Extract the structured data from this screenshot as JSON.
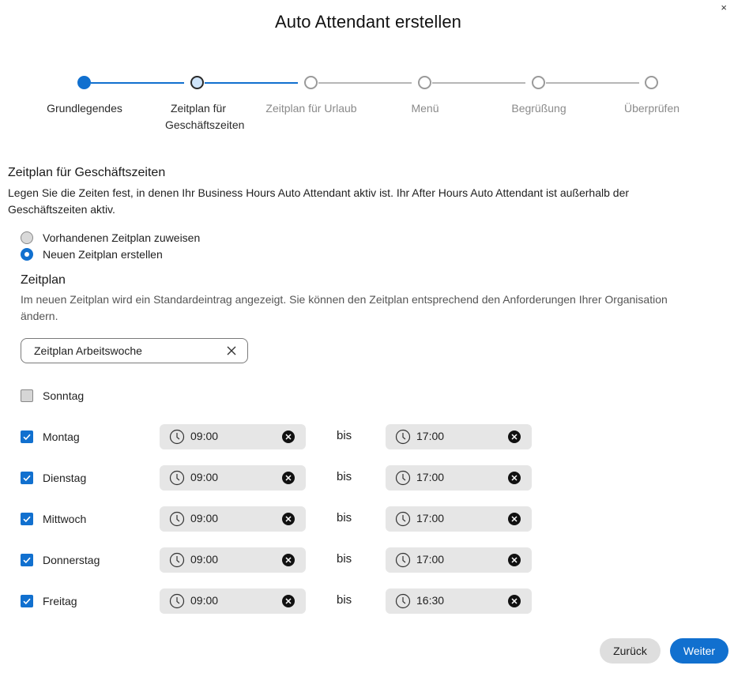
{
  "dialog": {
    "title": "Auto Attendant erstellen",
    "close_glyph": "×"
  },
  "stepper": {
    "steps": [
      {
        "label": "Grundlegendes",
        "state": "done"
      },
      {
        "label": "Zeitplan für Geschäftszeiten",
        "state": "current"
      },
      {
        "label": "Zeitplan für Urlaub",
        "state": "pending"
      },
      {
        "label": "Menü",
        "state": "pending"
      },
      {
        "label": "Begrüßung",
        "state": "pending"
      },
      {
        "label": "Überprüfen",
        "state": "pending"
      }
    ]
  },
  "section": {
    "title": "Zeitplan für Geschäftszeiten",
    "description": "Legen Sie die Zeiten fest, in denen Ihr Business Hours Auto Attendant aktiv ist. Ihr After Hours Auto Attendant ist außerhalb der Geschäftszeiten aktiv."
  },
  "schedule_mode": {
    "options": [
      {
        "label": "Vorhandenen Zeitplan zuweisen",
        "selected": false
      },
      {
        "label": "Neuen Zeitplan erstellen",
        "selected": true
      }
    ]
  },
  "schedule": {
    "title": "Zeitplan",
    "description": "Im neuen Zeitplan wird ein Standardeintrag angezeigt. Sie können den Zeitplan entsprechend den Anforderungen Ihrer Organisation ändern.",
    "name_value": "Zeitplan Arbeitswoche"
  },
  "days": {
    "separator": "bis",
    "rows": [
      {
        "label": "Sonntag",
        "checked": false
      },
      {
        "label": "Montag",
        "checked": true,
        "start": "09:00",
        "end": "17:00"
      },
      {
        "label": "Dienstag",
        "checked": true,
        "start": "09:00",
        "end": "17:00"
      },
      {
        "label": "Mittwoch",
        "checked": true,
        "start": "09:00",
        "end": "17:00"
      },
      {
        "label": "Donnerstag",
        "checked": true,
        "start": "09:00",
        "end": "17:00"
      },
      {
        "label": "Freitag",
        "checked": true,
        "start": "09:00",
        "end": "16:30"
      }
    ]
  },
  "footer": {
    "back_label": "Zurück",
    "next_label": "Weiter"
  },
  "colors": {
    "accent": "#1170cf",
    "pill_bg": "#e6e6e6"
  }
}
